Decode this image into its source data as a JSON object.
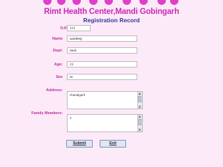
{
  "header": {
    "title": "Rimt Health Center,Mandi Gobingarh",
    "subtitle": "Registration Record"
  },
  "form": {
    "op_no": {
      "label": "O.P.No",
      "value": "111"
    },
    "name": {
      "label": "Name",
      "value": "sandeep"
    },
    "dept": {
      "label": "Dept:",
      "value": "med"
    },
    "age": {
      "label": "Age:",
      "value": "21"
    },
    "sex": {
      "label": "Sex",
      "value": "m"
    },
    "address": {
      "label": "Address:",
      "value": "chandigarh"
    },
    "family_members": {
      "label": "Family Members:",
      "value": "2"
    }
  },
  "buttons": {
    "submit": "Submit",
    "exit": "Exit"
  },
  "colors": {
    "background": "#fdeaf8",
    "title": "#c52bb5",
    "subtitle": "#2e3a9e",
    "label": "#c0299f"
  }
}
